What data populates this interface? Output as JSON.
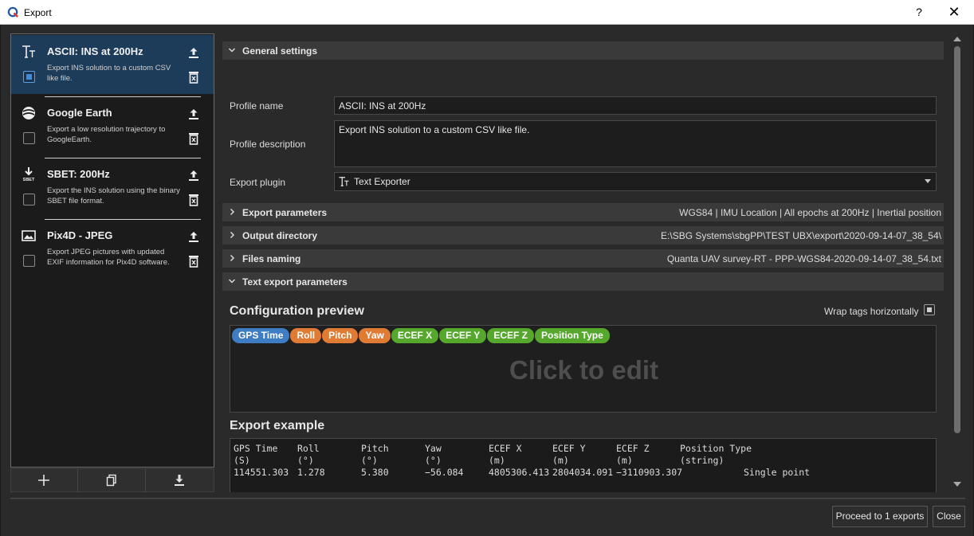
{
  "window": {
    "title": "Export",
    "help": "?",
    "close": "✕"
  },
  "profiles": [
    {
      "name": "ASCII: INS at 200Hz",
      "description": "Export INS solution to a custom CSV like file.",
      "icon": "text-exporter-icon",
      "checked": true
    },
    {
      "name": "Google Earth",
      "description": "Export a low resolution trajectory to GoogleEarth.",
      "icon": "google-earth-icon",
      "checked": false
    },
    {
      "name": "SBET: 200Hz",
      "description": "Export the INS solution using the binary SBET file format.",
      "icon": "sbet-download-icon",
      "checked": false,
      "icon_text": "SBET"
    },
    {
      "name": "Pix4D - JPEG",
      "description": "Export JPEG pictures with updated EXIF information for Pix4D software.",
      "icon": "image-icon",
      "checked": false
    }
  ],
  "general": {
    "title": "General settings",
    "profile_name_label": "Profile name",
    "profile_name_value": "ASCII: INS at 200Hz",
    "profile_desc_label": "Profile description",
    "profile_desc_value": "Export INS solution to a custom CSV like file.",
    "plugin_label": "Export plugin",
    "plugin_value": "Text Exporter"
  },
  "sections": {
    "export_params": {
      "title": "Export parameters",
      "summary": "WGS84 | IMU Location | All epochs at 200Hz | Inertial position"
    },
    "output_dir": {
      "title": "Output directory",
      "summary": "E:\\SBG Systems\\sbgPP\\TEST UBX\\export\\2020-09-14-07_38_54\\"
    },
    "files_naming": {
      "title": "Files naming",
      "summary": "Quanta UAV survey-RT - PPP-WGS84-2020-09-14-07_38_54.txt"
    },
    "text_export": {
      "title": "Text export parameters"
    }
  },
  "preview": {
    "title": "Configuration preview",
    "wrap_label": "Wrap tags horizontally",
    "click_to_edit": "Click to edit",
    "tags": [
      {
        "label": "GPS Time",
        "color": "#3e7cc4"
      },
      {
        "label": "Roll",
        "color": "#e07b33"
      },
      {
        "label": "Pitch",
        "color": "#e07b33"
      },
      {
        "label": "Yaw",
        "color": "#e07b33"
      },
      {
        "label": "ECEF X",
        "color": "#55a82c"
      },
      {
        "label": "ECEF Y",
        "color": "#55a82c"
      },
      {
        "label": "ECEF Z",
        "color": "#55a82c"
      },
      {
        "label": "Position Type",
        "color": "#55a82c"
      }
    ]
  },
  "example": {
    "title": "Export example",
    "headers": [
      "GPS Time",
      "Roll",
      "Pitch",
      "Yaw",
      "ECEF X",
      "ECEF Y",
      "ECEF Z",
      "Position Type"
    ],
    "units": [
      "(S)",
      "(°)",
      "(°)",
      "(°)",
      "(m)",
      "(m)",
      "(m)",
      "(string)"
    ],
    "values": [
      "114551.303",
      "1.278",
      "5.380",
      "−56.084",
      "4805306.413",
      "2804034.091",
      "−3110903.307",
      "Single point"
    ]
  },
  "footer": {
    "proceed": "Proceed to 1 exports",
    "close": "Close"
  }
}
